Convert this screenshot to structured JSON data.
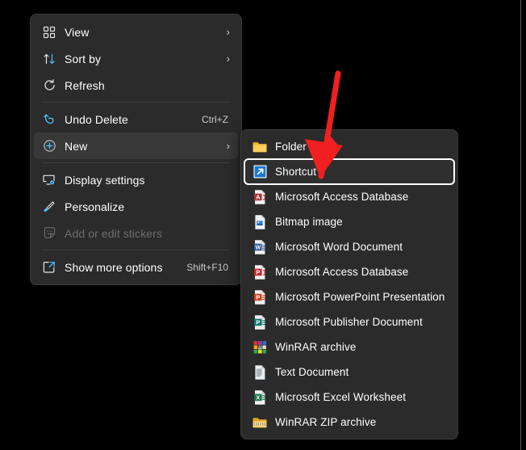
{
  "desktop": {
    "background_color": "#000000",
    "window_edge_color": "#5a6063"
  },
  "context_menu": {
    "background_color": "#2b2b2b",
    "accent_color": "#4cc2ff",
    "groups": [
      {
        "items": [
          {
            "icon": "view-grid-icon",
            "label": "View",
            "accel": "",
            "submenu_arrow": "›",
            "state": "normal"
          },
          {
            "icon": "sort-arrows-icon",
            "label": "Sort by",
            "accel": "",
            "submenu_arrow": "›",
            "state": "normal"
          },
          {
            "icon": "refresh-icon",
            "label": "Refresh",
            "accel": "",
            "submenu_arrow": "",
            "state": "normal"
          }
        ]
      },
      {
        "items": [
          {
            "icon": "undo-icon",
            "label": "Undo Delete",
            "accel": "Ctrl+Z",
            "submenu_arrow": "",
            "state": "normal"
          },
          {
            "icon": "new-plus-icon",
            "label": "New",
            "accel": "",
            "submenu_arrow": "›",
            "state": "highlight"
          }
        ]
      },
      {
        "items": [
          {
            "icon": "display-settings-icon",
            "label": "Display settings",
            "accel": "",
            "submenu_arrow": "",
            "state": "normal"
          },
          {
            "icon": "personalize-brush-icon",
            "label": "Personalize",
            "accel": "",
            "submenu_arrow": "",
            "state": "normal"
          },
          {
            "icon": "sticker-icon",
            "label": "Add or edit stickers",
            "accel": "",
            "submenu_arrow": "",
            "state": "disabled"
          }
        ]
      },
      {
        "items": [
          {
            "icon": "show-more-options-icon",
            "label": "Show more options",
            "accel": "Shift+F10",
            "submenu_arrow": "",
            "state": "normal"
          }
        ]
      }
    ]
  },
  "new_submenu": {
    "background_color": "#2b2b2b",
    "focus_outline_color": "#ffffff",
    "items": [
      {
        "icon": "folder-icon",
        "label": "Folder",
        "state": "normal"
      },
      {
        "icon": "shortcut-icon",
        "label": "Shortcut",
        "state": "focused"
      },
      {
        "icon": "access-database-icon",
        "label": "Microsoft Access Database",
        "state": "normal"
      },
      {
        "icon": "bitmap-image-icon",
        "label": "Bitmap image",
        "state": "normal"
      },
      {
        "icon": "word-document-icon",
        "label": "Microsoft Word Document",
        "state": "normal"
      },
      {
        "icon": "access-database-alt-icon",
        "label": "Microsoft Access Database",
        "state": "normal"
      },
      {
        "icon": "powerpoint-presentation-icon",
        "label": "Microsoft PowerPoint Presentation",
        "state": "normal"
      },
      {
        "icon": "publisher-document-icon",
        "label": "Microsoft Publisher Document",
        "state": "normal"
      },
      {
        "icon": "winrar-archive-icon",
        "label": "WinRAR archive",
        "state": "normal"
      },
      {
        "icon": "text-document-icon",
        "label": "Text Document",
        "state": "normal"
      },
      {
        "icon": "excel-worksheet-icon",
        "label": "Microsoft Excel Worksheet",
        "state": "normal"
      },
      {
        "icon": "winrar-zip-archive-icon",
        "label": "WinRAR ZIP archive",
        "state": "normal"
      }
    ]
  },
  "annotation": {
    "type": "arrow",
    "color": "#f02020",
    "points_to": "Shortcut"
  }
}
